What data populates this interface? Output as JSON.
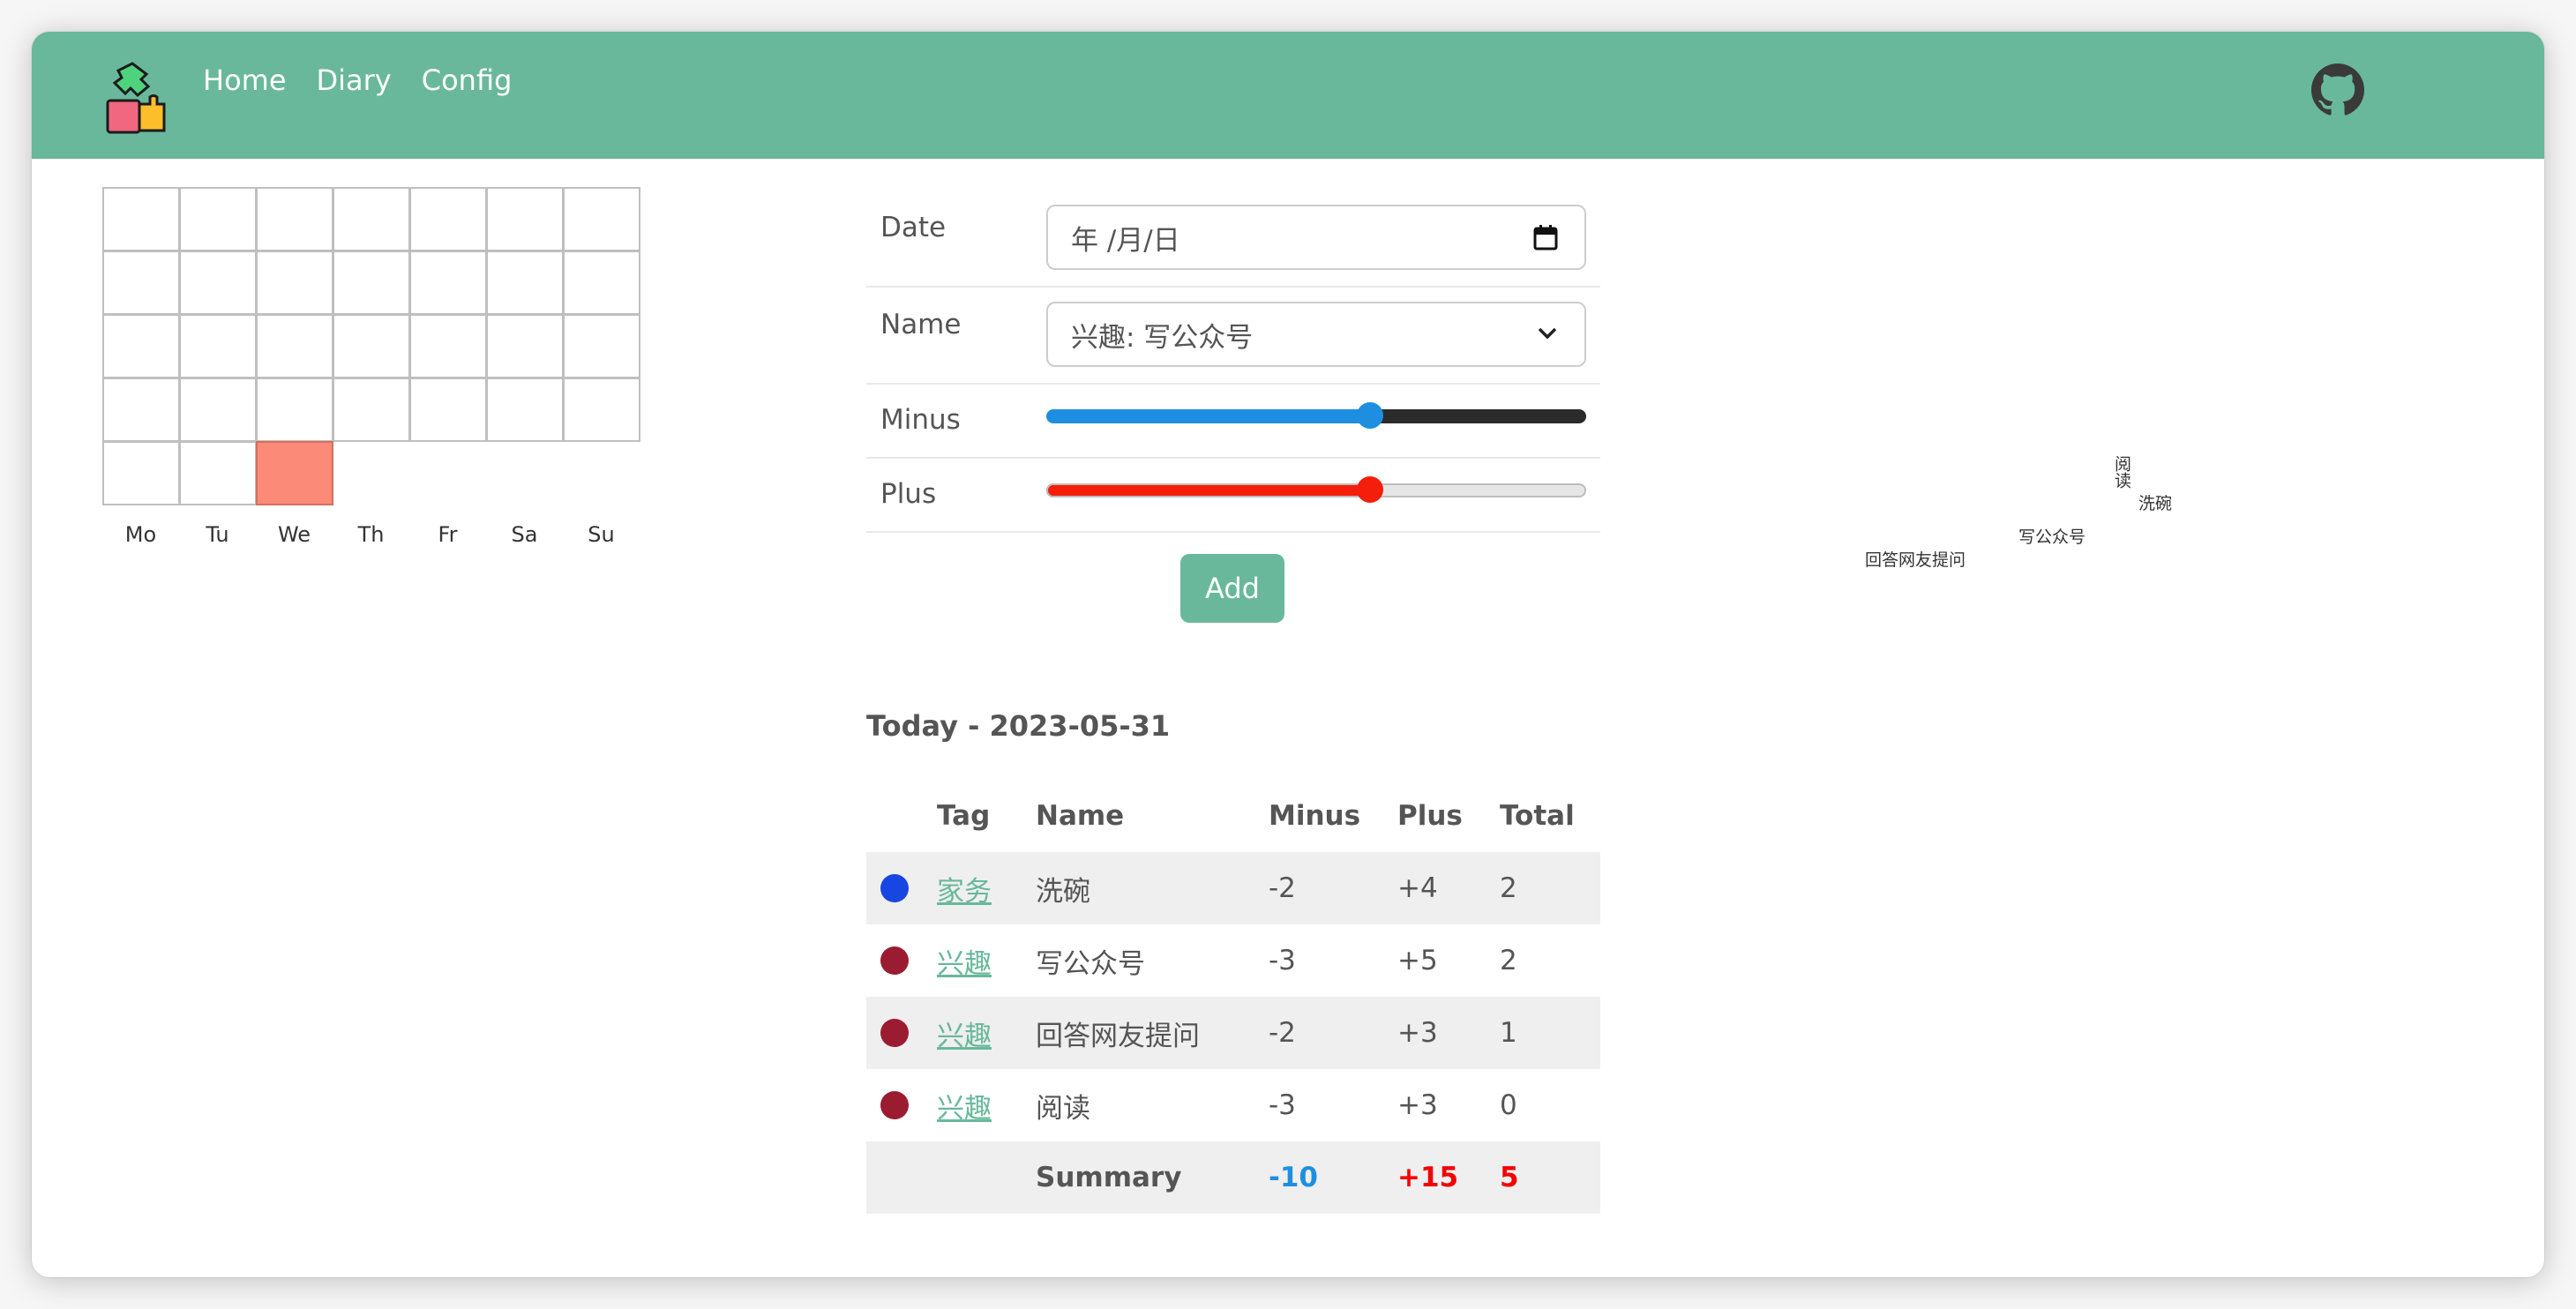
{
  "navbar": {
    "links": [
      "Home",
      "Diary",
      "Config"
    ],
    "colors": {
      "navbar_bg": "#69b89c",
      "link": "#ffffff"
    },
    "logo_icon": "puzzle-logo-icon",
    "github_icon": "github-icon"
  },
  "heatmap": {
    "weekdays": [
      "Mo",
      "Tu",
      "We",
      "Th",
      "Fr",
      "Sa",
      "Su"
    ],
    "weeks": 5,
    "active_cell": {
      "week": 5,
      "weekday": "We"
    },
    "colors": {
      "active": "#fb8b78",
      "border": "#bfbfbf"
    }
  },
  "form": {
    "date_label": "Date",
    "date_value": "年 /月/日",
    "name_label": "Name",
    "name_value": "兴趣: 写公众号",
    "minus_label": "Minus",
    "minus_level": 0.6,
    "plus_label": "Plus",
    "plus_level": 0.6,
    "add_label": "Add",
    "colors": {
      "minus": "#1e8fe0",
      "plus": "#f41e0a"
    }
  },
  "today": {
    "title": "Today - 2023-05-31",
    "headers": [
      "Tag",
      "Name",
      "Minus",
      "Plus",
      "Total"
    ],
    "rows": [
      {
        "color": "#1746e0",
        "tag": "家务",
        "name": "洗碗",
        "minus": "-2",
        "plus": "+4",
        "total": "2"
      },
      {
        "color": "#9b1c31",
        "tag": "兴趣",
        "name": "写公众号",
        "minus": "-3",
        "plus": "+5",
        "total": "2"
      },
      {
        "color": "#9b1c31",
        "tag": "兴趣",
        "name": "回答网友提问",
        "minus": "-2",
        "plus": "+3",
        "total": "1"
      },
      {
        "color": "#9b1c31",
        "tag": "兴趣",
        "name": "阅读",
        "minus": "-3",
        "plus": "+3",
        "total": "0"
      }
    ],
    "summary": {
      "label": "Summary",
      "minus": "-10",
      "plus": "+15",
      "total": "5"
    }
  },
  "word_cloud": {
    "words": [
      "阅读",
      "洗碗",
      "写公众号",
      "回答网友提问"
    ]
  }
}
